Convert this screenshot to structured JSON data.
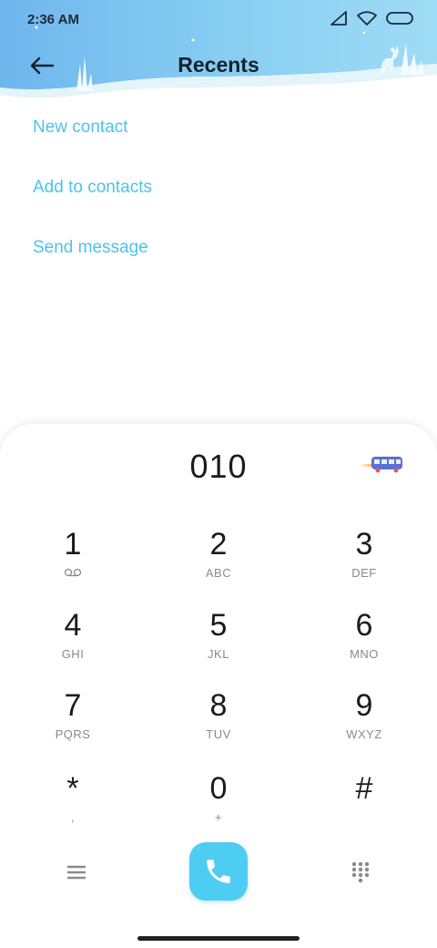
{
  "status_bar": {
    "time": "2:36 AM",
    "icons": [
      "signal-icon",
      "wifi-icon",
      "battery-icon"
    ]
  },
  "header": {
    "title": "Recents",
    "back_icon": "arrow-left-icon"
  },
  "actions": [
    {
      "label": "New contact"
    },
    {
      "label": "Add to contacts"
    },
    {
      "label": "Send message"
    }
  ],
  "dialer": {
    "number": "010",
    "keys": [
      {
        "digit": "1",
        "letters": ""
      },
      {
        "digit": "2",
        "letters": "ABC"
      },
      {
        "digit": "3",
        "letters": "DEF"
      },
      {
        "digit": "4",
        "letters": "GHI"
      },
      {
        "digit": "5",
        "letters": "JKL"
      },
      {
        "digit": "6",
        "letters": "MNO"
      },
      {
        "digit": "7",
        "letters": "PQRS"
      },
      {
        "digit": "8",
        "letters": "TUV"
      },
      {
        "digit": "9",
        "letters": "WXYZ"
      },
      {
        "digit": "*",
        "letters": ","
      },
      {
        "digit": "0",
        "letters": "+"
      },
      {
        "digit": "#",
        "letters": ""
      }
    ]
  },
  "colors": {
    "accent": "#4cc3ea",
    "call_button": "#4ecdf2",
    "header_sky": "#7fc8ef"
  }
}
